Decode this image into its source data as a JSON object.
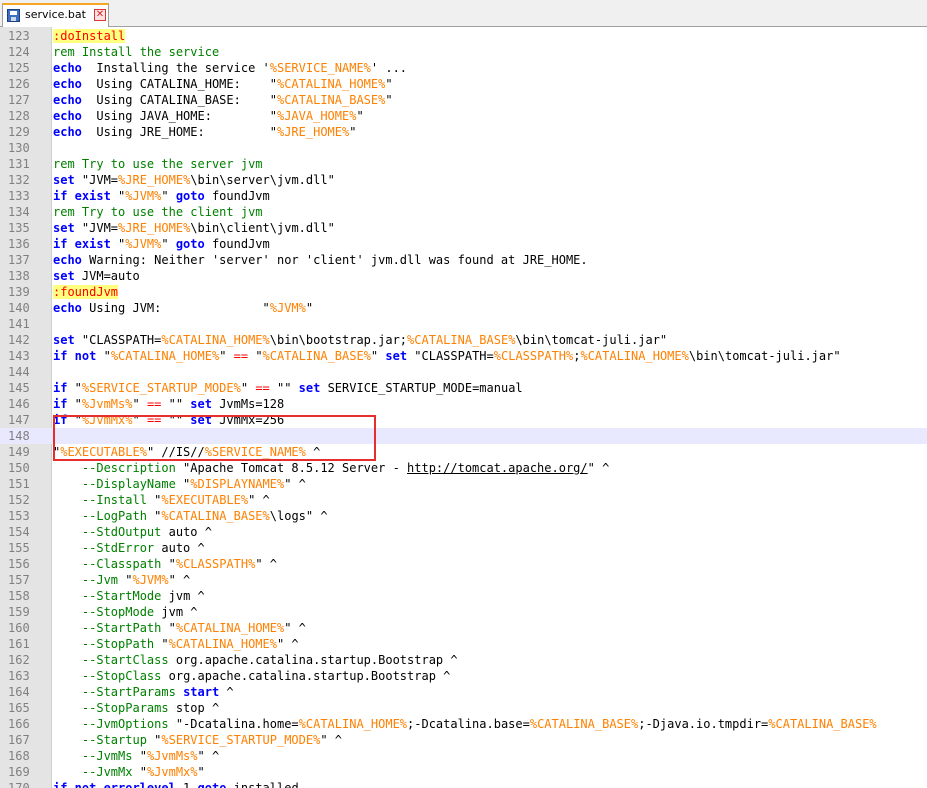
{
  "tab": {
    "title": "service.bat",
    "save_icon": "save-icon",
    "close_icon": "close-icon",
    "close_glyph": "✕"
  },
  "lines": [
    {
      "n": "123",
      "t": [
        [
          "lbl",
          ":doInstall"
        ]
      ]
    },
    {
      "n": "124",
      "t": [
        [
          "cm",
          "rem Install the service"
        ]
      ]
    },
    {
      "n": "125",
      "t": [
        [
          "kw",
          "echo"
        ],
        [
          "",
          "  Installing the service '"
        ],
        [
          "var",
          "%SERVICE_NAME%"
        ],
        [
          "",
          "' ..."
        ]
      ]
    },
    {
      "n": "126",
      "t": [
        [
          "kw",
          "echo"
        ],
        [
          "",
          "  Using CATALINA_HOME:    \""
        ],
        [
          "var",
          "%CATALINA_HOME%"
        ],
        [
          "",
          "\""
        ]
      ]
    },
    {
      "n": "127",
      "t": [
        [
          "kw",
          "echo"
        ],
        [
          "",
          "  Using CATALINA_BASE:    \""
        ],
        [
          "var",
          "%CATALINA_BASE%"
        ],
        [
          "",
          "\""
        ]
      ]
    },
    {
      "n": "128",
      "t": [
        [
          "kw",
          "echo"
        ],
        [
          "",
          "  Using JAVA_HOME:        \""
        ],
        [
          "var",
          "%JAVA_HOME%"
        ],
        [
          "",
          "\""
        ]
      ]
    },
    {
      "n": "129",
      "t": [
        [
          "kw",
          "echo"
        ],
        [
          "",
          "  Using JRE_HOME:         \""
        ],
        [
          "var",
          "%JRE_HOME%"
        ],
        [
          "",
          "\""
        ]
      ]
    },
    {
      "n": "130",
      "t": []
    },
    {
      "n": "131",
      "t": [
        [
          "cm",
          "rem Try to use the server jvm"
        ]
      ]
    },
    {
      "n": "132",
      "t": [
        [
          "kw",
          "set"
        ],
        [
          "",
          " \"JVM="
        ],
        [
          "var",
          "%JRE_HOME%"
        ],
        [
          "",
          "\\bin\\server\\jvm.dll\""
        ]
      ]
    },
    {
      "n": "133",
      "t": [
        [
          "kw",
          "if exist"
        ],
        [
          "",
          " \""
        ],
        [
          "var",
          "%JVM%"
        ],
        [
          "",
          "\" "
        ],
        [
          "kw",
          "goto"
        ],
        [
          "",
          " foundJvm"
        ]
      ]
    },
    {
      "n": "134",
      "t": [
        [
          "cm",
          "rem Try to use the client jvm"
        ]
      ]
    },
    {
      "n": "135",
      "t": [
        [
          "kw",
          "set"
        ],
        [
          "",
          " \"JVM="
        ],
        [
          "var",
          "%JRE_HOME%"
        ],
        [
          "",
          "\\bin\\client\\jvm.dll\""
        ]
      ]
    },
    {
      "n": "136",
      "t": [
        [
          "kw",
          "if exist"
        ],
        [
          "",
          " \""
        ],
        [
          "var",
          "%JVM%"
        ],
        [
          "",
          "\" "
        ],
        [
          "kw",
          "goto"
        ],
        [
          "",
          " foundJvm"
        ]
      ]
    },
    {
      "n": "137",
      "t": [
        [
          "kw",
          "echo"
        ],
        [
          "",
          " Warning: Neither 'server' nor 'client' jvm.dll was found at JRE_HOME."
        ]
      ]
    },
    {
      "n": "138",
      "t": [
        [
          "kw",
          "set"
        ],
        [
          "",
          " JVM=auto"
        ]
      ]
    },
    {
      "n": "139",
      "t": [
        [
          "lbl",
          ":foundJvm"
        ]
      ]
    },
    {
      "n": "140",
      "t": [
        [
          "kw",
          "echo"
        ],
        [
          "",
          " Using JVM:              \""
        ],
        [
          "var",
          "%JVM%"
        ],
        [
          "",
          "\""
        ]
      ]
    },
    {
      "n": "141",
      "t": []
    },
    {
      "n": "142",
      "t": [
        [
          "kw",
          "set"
        ],
        [
          "",
          " \"CLASSPATH="
        ],
        [
          "var",
          "%CATALINA_HOME%"
        ],
        [
          "",
          "\\bin\\bootstrap.jar;"
        ],
        [
          "var",
          "%CATALINA_BASE%"
        ],
        [
          "",
          "\\bin\\tomcat-juli.jar\""
        ]
      ]
    },
    {
      "n": "143",
      "t": [
        [
          "kw",
          "if not"
        ],
        [
          "",
          " \""
        ],
        [
          "var",
          "%CATALINA_HOME%"
        ],
        [
          "",
          "\" "
        ],
        [
          "op",
          "=="
        ],
        [
          "",
          " \""
        ],
        [
          "var",
          "%CATALINA_BASE%"
        ],
        [
          "",
          "\" "
        ],
        [
          "kw",
          "set"
        ],
        [
          "",
          " \"CLASSPATH="
        ],
        [
          "var",
          "%CLASSPATH%"
        ],
        [
          "",
          ";"
        ],
        [
          "var",
          "%CATALINA_HOME%"
        ],
        [
          "",
          "\\bin\\tomcat-juli.jar\""
        ]
      ]
    },
    {
      "n": "144",
      "t": []
    },
    {
      "n": "145",
      "t": [
        [
          "kw",
          "if"
        ],
        [
          "",
          " \""
        ],
        [
          "var",
          "%SERVICE_STARTUP_MODE%"
        ],
        [
          "",
          "\" "
        ],
        [
          "op",
          "=="
        ],
        [
          "",
          " \"\" "
        ],
        [
          "kw",
          "set"
        ],
        [
          "",
          " SERVICE_STARTUP_MODE=manual"
        ]
      ]
    },
    {
      "n": "146",
      "t": [
        [
          "kw",
          "if"
        ],
        [
          "",
          " \""
        ],
        [
          "var",
          "%JvmMs%"
        ],
        [
          "",
          "\" "
        ],
        [
          "op",
          "=="
        ],
        [
          "",
          " \"\" "
        ],
        [
          "kw",
          "set"
        ],
        [
          "",
          " JvmMs=128"
        ]
      ]
    },
    {
      "n": "147",
      "t": [
        [
          "kw",
          "if"
        ],
        [
          "",
          " \""
        ],
        [
          "var",
          "%JvmMx%"
        ],
        [
          "",
          "\" "
        ],
        [
          "op",
          "=="
        ],
        [
          "",
          " \"\" "
        ],
        [
          "kw",
          "set"
        ],
        [
          "",
          " JvmMx=256"
        ]
      ]
    },
    {
      "n": "148",
      "t": [],
      "current": true
    },
    {
      "n": "149",
      "t": [
        [
          "",
          "\""
        ],
        [
          "var",
          "%EXECUTABLE%"
        ],
        [
          "",
          "\" //IS//"
        ],
        [
          "var",
          "%SERVICE_NAME%"
        ],
        [
          "",
          " ^"
        ]
      ]
    },
    {
      "n": "150",
      "t": [
        [
          "",
          "    "
        ],
        [
          "cm",
          "--Description"
        ],
        [
          "",
          " \"Apache Tomcat 8.5.12 Server - "
        ],
        [
          "url",
          "http://tomcat.apache.org/"
        ],
        [
          "",
          "\" ^"
        ]
      ]
    },
    {
      "n": "151",
      "t": [
        [
          "",
          "    "
        ],
        [
          "cm",
          "--DisplayName"
        ],
        [
          "",
          " \""
        ],
        [
          "var",
          "%DISPLAYNAME%"
        ],
        [
          "",
          "\" ^"
        ]
      ]
    },
    {
      "n": "152",
      "t": [
        [
          "",
          "    "
        ],
        [
          "cm",
          "--Install"
        ],
        [
          "",
          " \""
        ],
        [
          "var",
          "%EXECUTABLE%"
        ],
        [
          "",
          "\" ^"
        ]
      ]
    },
    {
      "n": "153",
      "t": [
        [
          "",
          "    "
        ],
        [
          "cm",
          "--LogPath"
        ],
        [
          "",
          " \""
        ],
        [
          "var",
          "%CATALINA_BASE%"
        ],
        [
          "",
          "\\logs\" ^"
        ]
      ]
    },
    {
      "n": "154",
      "t": [
        [
          "",
          "    "
        ],
        [
          "cm",
          "--StdOutput"
        ],
        [
          "",
          " auto ^"
        ]
      ]
    },
    {
      "n": "155",
      "t": [
        [
          "",
          "    "
        ],
        [
          "cm",
          "--StdError"
        ],
        [
          "",
          " auto ^"
        ]
      ]
    },
    {
      "n": "156",
      "t": [
        [
          "",
          "    "
        ],
        [
          "cm",
          "--Classpath"
        ],
        [
          "",
          " \""
        ],
        [
          "var",
          "%CLASSPATH%"
        ],
        [
          "",
          "\" ^"
        ]
      ]
    },
    {
      "n": "157",
      "t": [
        [
          "",
          "    "
        ],
        [
          "cm",
          "--Jvm"
        ],
        [
          "",
          " \""
        ],
        [
          "var",
          "%JVM%"
        ],
        [
          "",
          "\" ^"
        ]
      ]
    },
    {
      "n": "158",
      "t": [
        [
          "",
          "    "
        ],
        [
          "cm",
          "--StartMode"
        ],
        [
          "",
          " jvm ^"
        ]
      ]
    },
    {
      "n": "159",
      "t": [
        [
          "",
          "    "
        ],
        [
          "cm",
          "--StopMode"
        ],
        [
          "",
          " jvm ^"
        ]
      ]
    },
    {
      "n": "160",
      "t": [
        [
          "",
          "    "
        ],
        [
          "cm",
          "--StartPath"
        ],
        [
          "",
          " \""
        ],
        [
          "var",
          "%CATALINA_HOME%"
        ],
        [
          "",
          "\" ^"
        ]
      ]
    },
    {
      "n": "161",
      "t": [
        [
          "",
          "    "
        ],
        [
          "cm",
          "--StopPath"
        ],
        [
          "",
          " \""
        ],
        [
          "var",
          "%CATALINA_HOME%"
        ],
        [
          "",
          "\" ^"
        ]
      ]
    },
    {
      "n": "162",
      "t": [
        [
          "",
          "    "
        ],
        [
          "cm",
          "--StartClass"
        ],
        [
          "",
          " org.apache.catalina.startup.Bootstrap ^"
        ]
      ]
    },
    {
      "n": "163",
      "t": [
        [
          "",
          "    "
        ],
        [
          "cm",
          "--StopClass"
        ],
        [
          "",
          " org.apache.catalina.startup.Bootstrap ^"
        ]
      ]
    },
    {
      "n": "164",
      "t": [
        [
          "",
          "    "
        ],
        [
          "cm",
          "--StartParams"
        ],
        [
          "",
          " "
        ],
        [
          "kw",
          "start"
        ],
        [
          "",
          " ^"
        ]
      ]
    },
    {
      "n": "165",
      "t": [
        [
          "",
          "    "
        ],
        [
          "cm",
          "--StopParams"
        ],
        [
          "",
          " stop ^"
        ]
      ]
    },
    {
      "n": "166",
      "t": [
        [
          "",
          "    "
        ],
        [
          "cm",
          "--JvmOptions"
        ],
        [
          "",
          " \"-Dcatalina.home="
        ],
        [
          "var",
          "%CATALINA_HOME%"
        ],
        [
          "",
          ";-Dcatalina.base="
        ],
        [
          "var",
          "%CATALINA_BASE%"
        ],
        [
          "",
          ";-Djava.io.tmpdir="
        ],
        [
          "var",
          "%CATALINA_BASE%"
        ]
      ]
    },
    {
      "n": "167",
      "t": [
        [
          "",
          "    "
        ],
        [
          "cm",
          "--Startup"
        ],
        [
          "",
          " \""
        ],
        [
          "var",
          "%SERVICE_STARTUP_MODE%"
        ],
        [
          "",
          "\" ^"
        ]
      ]
    },
    {
      "n": "168",
      "t": [
        [
          "",
          "    "
        ],
        [
          "cm",
          "--JvmMs"
        ],
        [
          "",
          " \""
        ],
        [
          "var",
          "%JvmMs%"
        ],
        [
          "",
          "\" ^"
        ]
      ]
    },
    {
      "n": "169",
      "t": [
        [
          "",
          "    "
        ],
        [
          "cm",
          "--JvmMx"
        ],
        [
          "",
          " \""
        ],
        [
          "var",
          "%JvmMx%"
        ],
        [
          "",
          "\""
        ]
      ]
    },
    {
      "n": "170",
      "t": [
        [
          "kw",
          "if not errorlevel"
        ],
        [
          "",
          " 1 "
        ],
        [
          "kw",
          "goto"
        ],
        [
          "",
          " installed"
        ]
      ]
    }
  ]
}
